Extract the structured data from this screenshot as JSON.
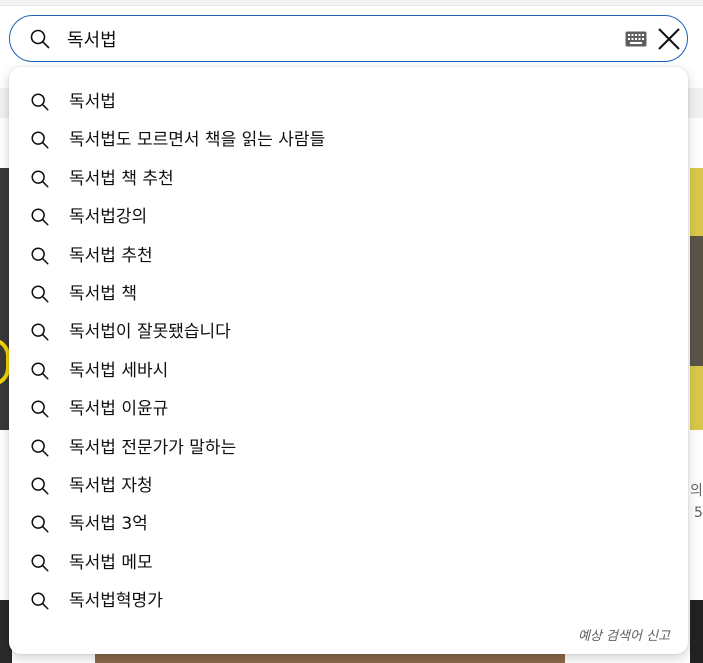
{
  "search": {
    "query": "독서법",
    "icon": "search-icon",
    "keyboard_icon": "keyboard-icon",
    "clear_icon": "close-icon",
    "border_color": "#1c62b9"
  },
  "suggestions": [
    {
      "label": "독서법"
    },
    {
      "label": "독서법도 모르면서 책을 읽는 사람들"
    },
    {
      "label": "독서법 책 추천"
    },
    {
      "label": "독서법강의"
    },
    {
      "label": "독서법 추천"
    },
    {
      "label": "독서법 책"
    },
    {
      "label": "독서법이 잘못됐습니다"
    },
    {
      "label": "독서법 세바시"
    },
    {
      "label": "독서법 이윤규"
    },
    {
      "label": "독서법 전문가가 말하는"
    },
    {
      "label": "독서법 자청"
    },
    {
      "label": "독서법 3억"
    },
    {
      "label": "독서법 메모"
    },
    {
      "label": "독서법혁명가"
    }
  ],
  "report_link": "예상 검색어 신고",
  "background": {
    "right_text_2": "의",
    "right_text_3": "5"
  }
}
